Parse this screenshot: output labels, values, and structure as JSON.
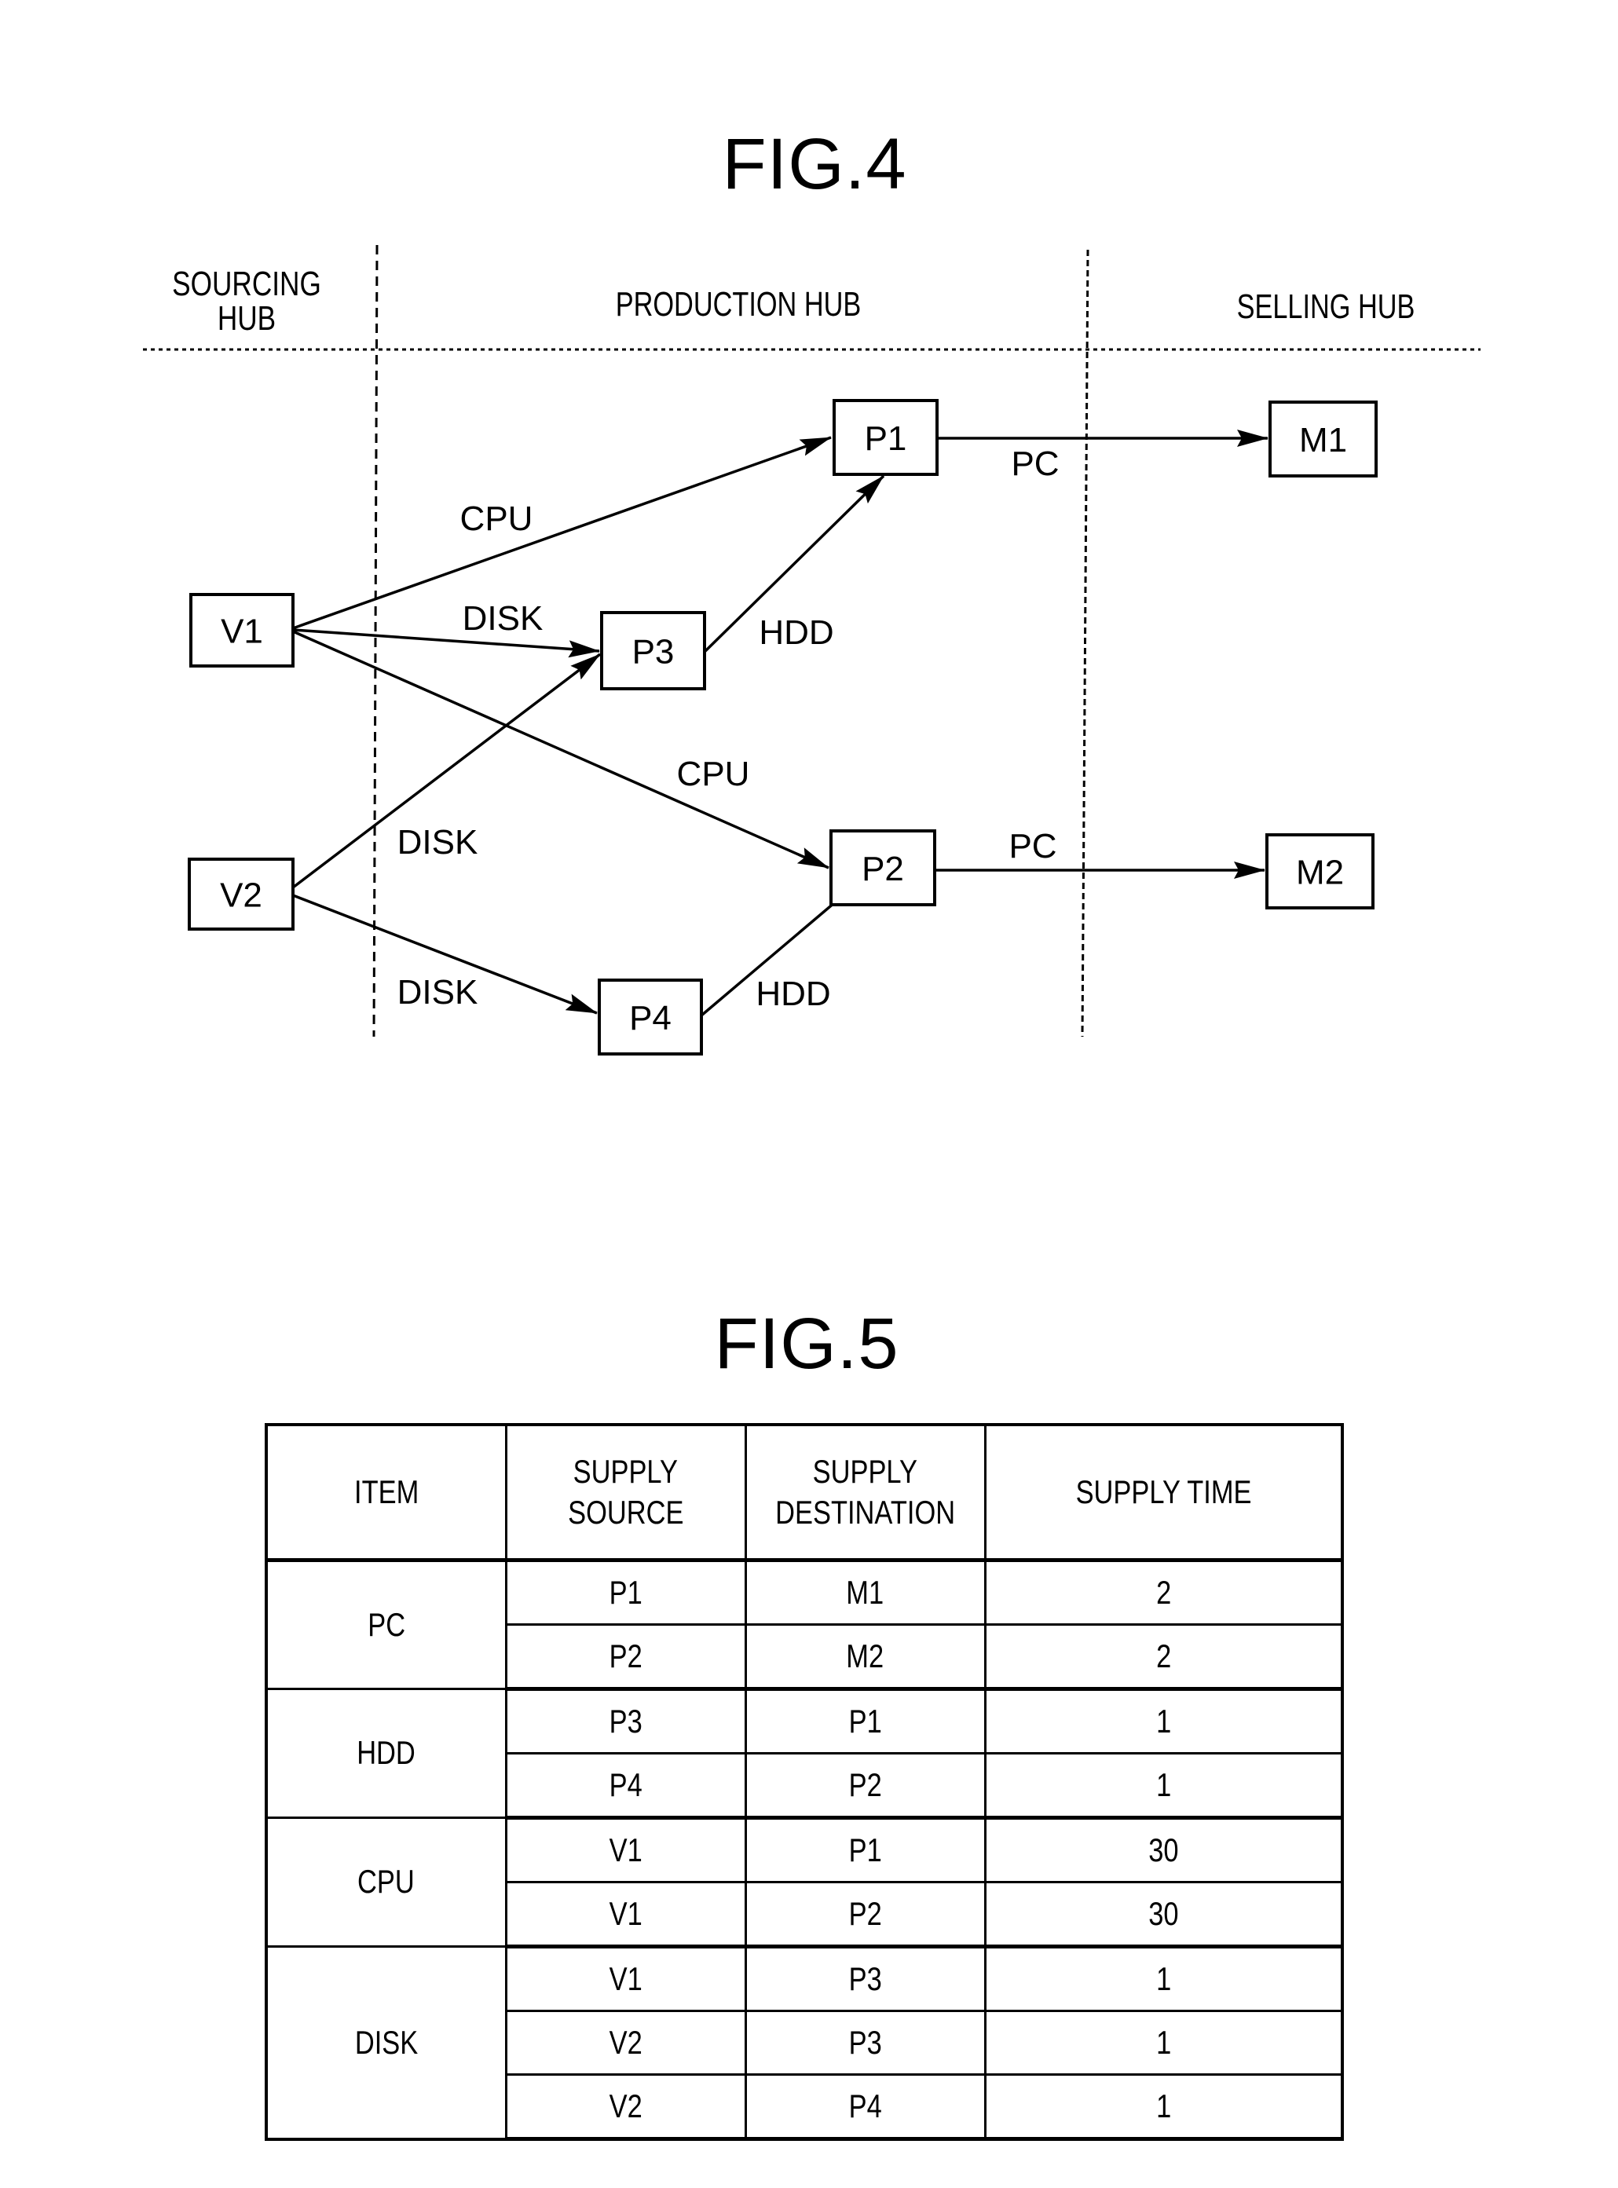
{
  "fig4": {
    "title": "FIG.4",
    "hubs": {
      "sourcing": [
        "SOURCING",
        "HUB"
      ],
      "production": "PRODUCTION HUB",
      "selling": "SELLING HUB"
    },
    "nodes": [
      {
        "id": "V1",
        "label": "V1",
        "hub": "sourcing"
      },
      {
        "id": "V2",
        "label": "V2",
        "hub": "sourcing"
      },
      {
        "id": "P1",
        "label": "P1",
        "hub": "production"
      },
      {
        "id": "P2",
        "label": "P2",
        "hub": "production"
      },
      {
        "id": "P3",
        "label": "P3",
        "hub": "production"
      },
      {
        "id": "P4",
        "label": "P4",
        "hub": "production"
      },
      {
        "id": "M1",
        "label": "M1",
        "hub": "selling"
      },
      {
        "id": "M2",
        "label": "M2",
        "hub": "selling"
      }
    ],
    "edges": [
      {
        "from": "V1",
        "to": "P1",
        "label": "CPU"
      },
      {
        "from": "V1",
        "to": "P3",
        "label": "DISK"
      },
      {
        "from": "V1",
        "to": "P2",
        "label": "CPU"
      },
      {
        "from": "V2",
        "to": "P3",
        "label": "DISK"
      },
      {
        "from": "V2",
        "to": "P4",
        "label": "DISK"
      },
      {
        "from": "P3",
        "to": "P1",
        "label": "HDD"
      },
      {
        "from": "P4",
        "to": "P2",
        "label": "HDD"
      },
      {
        "from": "P1",
        "to": "M1",
        "label": "PC"
      },
      {
        "from": "P2",
        "to": "M2",
        "label": "PC"
      }
    ]
  },
  "fig5": {
    "title": "FIG.5",
    "headers": [
      [
        "ITEM"
      ],
      [
        "SUPPLY",
        "SOURCE"
      ],
      [
        "SUPPLY",
        "DESTINATION"
      ],
      [
        "SUPPLY TIME"
      ]
    ],
    "groups": [
      {
        "item": "PC",
        "rows": [
          {
            "source": "P1",
            "destination": "M1",
            "time": "2"
          },
          {
            "source": "P2",
            "destination": "M2",
            "time": "2"
          }
        ]
      },
      {
        "item": "HDD",
        "rows": [
          {
            "source": "P3",
            "destination": "P1",
            "time": "1"
          },
          {
            "source": "P4",
            "destination": "P2",
            "time": "1"
          }
        ]
      },
      {
        "item": "CPU",
        "rows": [
          {
            "source": "V1",
            "destination": "P1",
            "time": "30"
          },
          {
            "source": "V1",
            "destination": "P2",
            "time": "30"
          }
        ]
      },
      {
        "item": "DISK",
        "rows": [
          {
            "source": "V1",
            "destination": "P3",
            "time": "1"
          },
          {
            "source": "V2",
            "destination": "P3",
            "time": "1"
          },
          {
            "source": "V2",
            "destination": "P4",
            "time": "1"
          }
        ]
      }
    ]
  }
}
